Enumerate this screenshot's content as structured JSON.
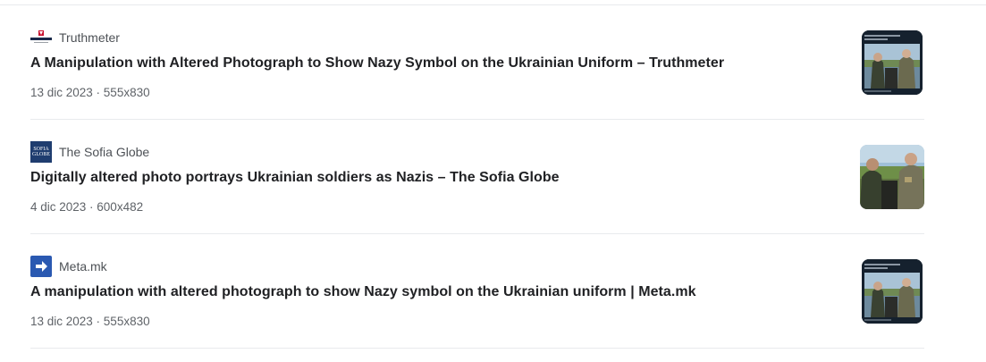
{
  "results": [
    {
      "source": "Truthmeter",
      "favicon": "truthmeter-logo-icon",
      "title": "A Manipulation with Altered Photograph to Show Nazy Symbol on the Ukrainian Uniform – Truthmeter",
      "meta": "13 dic 2023 · 555x830",
      "thumbnail": "soldiers-tweet-screenshot"
    },
    {
      "source": "The Sofia Globe",
      "favicon": "sofia-globe-logo-icon",
      "favicon_text": [
        "SOFIA",
        "GLOBE"
      ],
      "title": "Digitally altered photo portrays Ukrainian soldiers as Nazis – The Sofia Globe",
      "meta": "4 dic 2023 · 600x482",
      "thumbnail": "soldiers-photo"
    },
    {
      "source": "Meta.mk",
      "favicon": "meta-mk-arrow-icon",
      "title": "A manipulation with altered photograph to show Nazy symbol on the Ukrainian uniform | Meta.mk",
      "meta": "13 dic 2023 · 555x830",
      "thumbnail": "soldiers-tweet-screenshot"
    }
  ],
  "colors": {
    "title": "#202124",
    "source": "#4d5156",
    "meta": "#5f6368",
    "divider": "#e8eaed",
    "sofia_blue": "#1f3d6f",
    "meta_blue": "#2a59b1"
  }
}
